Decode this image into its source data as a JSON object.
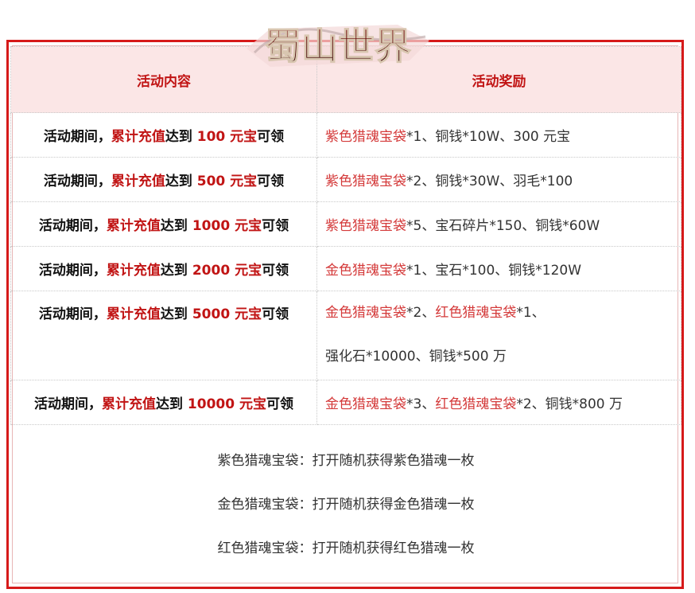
{
  "logo_text": "蜀山世界",
  "header": {
    "col1": "活动内容",
    "col2": "活动奖励"
  },
  "rows": [
    {
      "pre": "活动期间，",
      "mid": "累计充值",
      "reach": "达到 ",
      "amount": "100 元宝",
      "post": "可领",
      "reward_red": "紫色猎魂宝袋",
      "reward_rest": "*1、铜钱*10W、300 元宝"
    },
    {
      "pre": "活动期间，",
      "mid": "累计充值",
      "reach": "达到 ",
      "amount": "500 元宝",
      "post": "可领",
      "reward_red": "紫色猎魂宝袋",
      "reward_rest": "*2、铜钱*30W、羽毛*100"
    },
    {
      "pre": "活动期间，",
      "mid": "累计充值",
      "reach": "达到 ",
      "amount": "1000 元宝",
      "post": "可领",
      "reward_red": "紫色猎魂宝袋",
      "reward_rest": "*5、宝石碎片*150、铜钱*60W"
    },
    {
      "pre": "活动期间，",
      "mid": "累计充值",
      "reach": "达到 ",
      "amount": "2000 元宝",
      "post": "可领",
      "reward_red": "金色猎魂宝袋",
      "reward_rest": "*1、宝石*100、铜钱*120W"
    },
    {
      "pre": "活动期间，",
      "mid": "累计充值",
      "reach": "达到 ",
      "amount": "5000 元宝",
      "post": "可领",
      "reward_red": "金色猎魂宝袋",
      "reward_rest": "*2、",
      "reward_red2": "红色猎魂宝袋",
      "reward_rest2": "*1、",
      "reward_line2": "强化石*10000、铜钱*500 万"
    },
    {
      "pre": "活动期间，",
      "mid": "累计充值",
      "reach": "达到 ",
      "amount": "10000 元宝",
      "post": "可领",
      "reward_red": "金色猎魂宝袋",
      "reward_rest": "*3、",
      "reward_red2": "红色猎魂宝袋",
      "reward_rest2": "*2、铜钱*800 万"
    }
  ],
  "notes": [
    "紫色猎魂宝袋：打开随机获得紫色猎魂一枚",
    "金色猎魂宝袋：打开随机获得金色猎魂一枚",
    "红色猎魂宝袋：打开随机获得红色猎魂一枚"
  ],
  "colors": {
    "accent": "#c11414",
    "header_bg": "#fbe6e6",
    "frame": "#d61a1a"
  }
}
